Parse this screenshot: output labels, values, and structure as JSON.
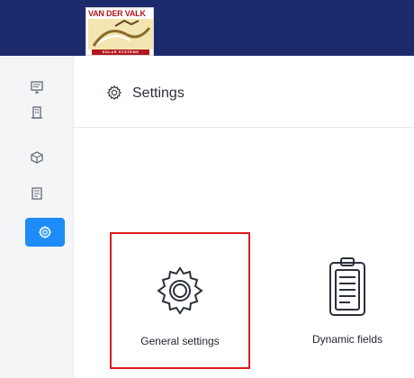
{
  "brand": {
    "logo_top_text": "VAN DER VALK",
    "logo_bottom_text": "SOLAR SYSTEMS"
  },
  "sidebar": {
    "items": [
      {
        "icon": "monitor-icon",
        "active": false
      },
      {
        "icon": "building-icon",
        "active": false
      },
      {
        "icon": "box-icon",
        "active": false
      },
      {
        "icon": "document-icon",
        "active": false
      },
      {
        "icon": "settings-icon",
        "active": true
      }
    ]
  },
  "header": {
    "title": "Settings",
    "icon": "settings-icon"
  },
  "cards": [
    {
      "label": "General settings",
      "icon": "gear-icon",
      "selected": true
    },
    {
      "label": "Dynamic fields",
      "icon": "clipboard-icon",
      "selected": false
    }
  ],
  "colors": {
    "topbar": "#1c2b6b",
    "active_nav": "#1d8cf8",
    "selection_border": "#e01b1b"
  }
}
